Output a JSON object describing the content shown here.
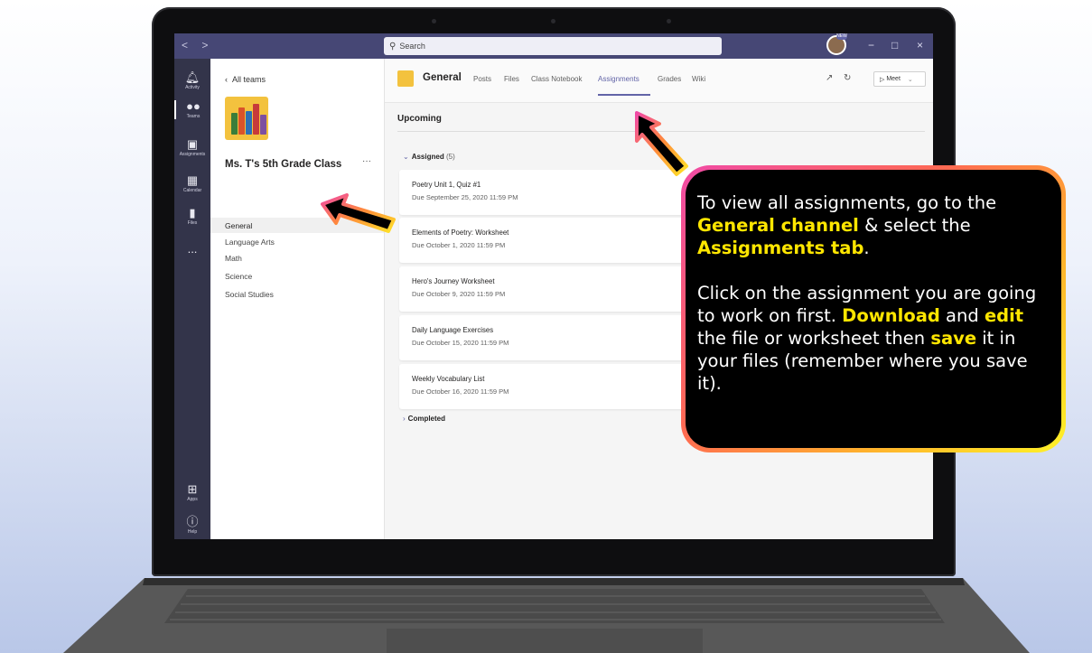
{
  "titlebar": {
    "nav": "< >",
    "search_placeholder": "Search",
    "avatar_badge": "NEW",
    "minimize": "−",
    "maximize": "□",
    "close": "×"
  },
  "rail": [
    {
      "label": "Activity",
      "icon": "bell-icon"
    },
    {
      "label": "Teams",
      "icon": "teams-icon"
    },
    {
      "label": "Assignments",
      "icon": "backpack-icon"
    },
    {
      "label": "Calendar",
      "icon": "calendar-icon"
    },
    {
      "label": "Files",
      "icon": "file-icon"
    },
    {
      "label": "...",
      "icon": "more-icon"
    },
    {
      "label": "Apps",
      "icon": "apps-icon"
    },
    {
      "label": "Help",
      "icon": "help-icon"
    }
  ],
  "teampanel": {
    "back_label": "All teams",
    "team_name": "Ms. T's 5th Grade Class",
    "more": "···",
    "channels": [
      "General",
      "Language Arts",
      "Math",
      "Science",
      "Social Studies"
    ]
  },
  "header": {
    "channel": "General",
    "tabs": [
      "Posts",
      "Files",
      "Class Notebook",
      "Assignments",
      "Grades",
      "Wiki"
    ],
    "active_tab": "Assignments",
    "meet_label": "Meet"
  },
  "assignments": {
    "upcoming_label": "Upcoming",
    "assigned_label": "Assigned",
    "assigned_count": "(5)",
    "completed_label": "Completed",
    "items": [
      {
        "title": "Poetry Unit 1, Quiz #1",
        "due": "Due September 25, 2020 11:59 PM"
      },
      {
        "title": "Elements of Poetry: Worksheet",
        "due": "Due October 1, 2020 11:59 PM"
      },
      {
        "title": "Hero's Journey Worksheet",
        "due": "Due October 9, 2020 11:59 PM"
      },
      {
        "title": "Daily Language Exercises",
        "due": "Due October 15, 2020 11:59 PM"
      },
      {
        "title": "Weekly Vocabulary List",
        "due": "Due October 16, 2020 11:59 PM"
      }
    ]
  },
  "callout": {
    "p1_a": "To view all assignments, go to the ",
    "p1_b": "General channel",
    "p1_c": " & select the ",
    "p1_d": "Assignments tab",
    "p1_e": ".",
    "p2_a": "Click on the assignment you are going to work on first. ",
    "p2_b": "Download",
    "p2_c": " and ",
    "p2_d": "edit",
    "p2_e": " the file or worksheet then ",
    "p2_f": "save",
    "p2_g": " it in your files (remember where you save it)."
  },
  "colors": {
    "teams_purple": "#464775",
    "rail": "#33344a",
    "accent": "#6264a7",
    "highlight": "#ffe600"
  }
}
